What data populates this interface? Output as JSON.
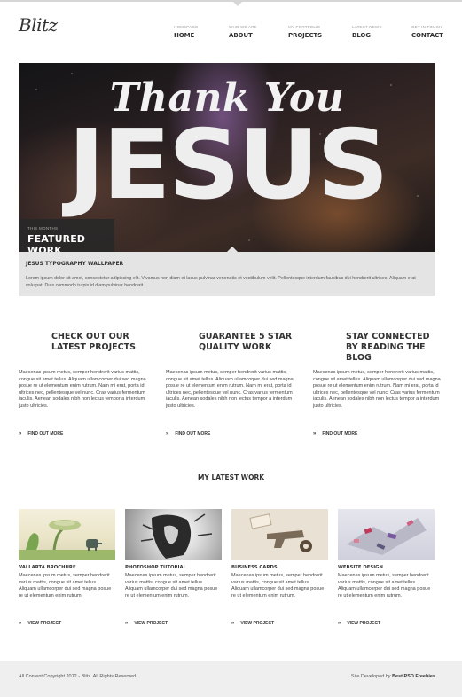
{
  "brand": {
    "logo": "Blitz"
  },
  "nav": [
    {
      "sub": "HOMEPAGE",
      "label": "HOME"
    },
    {
      "sub": "WHO WE ARE",
      "label": "ABOUT"
    },
    {
      "sub": "MY PORTFOLIO",
      "label": "PROJECTS"
    },
    {
      "sub": "LATEST NEWS",
      "label": "BLOG"
    },
    {
      "sub": "GET IN TOUCH",
      "label": "CONTACT"
    }
  ],
  "hero": {
    "line1": "Thank You",
    "line2": "JESUS",
    "featured_sub": "THIS MONTHS",
    "featured_title": "FEATURED WORK",
    "slide_count": 4,
    "active_slide": 4
  },
  "caption": {
    "title": "JESUS TYPOGRAPHY WALLPAPER",
    "text": "Lorem ipsum dolor sit amet, consectetur adipiscing elit. Vivamus non diam et lacus pulvinar venenatis et vestibulum velit. Pellentesque interdum faucibus dui hendrerit ultrices. Aliquam erat volutpat. Duis commodo turpis id diam pulvinar hendrerit."
  },
  "features": [
    {
      "title": "CHECK OUT OUR LATEST PROJECTS",
      "body": "Maecenas ipsum metus, semper hendrerit varius mattis, congue sit amet tellus. Aliquam ullamcorper dui sed magna posue re ut elementum enim rutrum. Nam mi erat, porta id ultrices nec, pellentesque vel nunc. Cras varius fermentum iaculis. Aenean sodales nibh non lectus tempor a interdum justo ultricies.",
      "link": "FIND OUT MORE"
    },
    {
      "title": "GUARANTEE 5 STAR QUALITY WORK",
      "body": "Maecenas ipsum metus, semper hendrerit varius mattis, congue sit amet tellus. Aliquam ullamcorper dui sed magna posue re ut elementum enim rutrum. Nam mi erat, porta id ultrices nec, pellentesque vel nunc. Cras varius fermentum iaculis. Aenean sodales nibh non lectus tempor a interdum justo ultricies.",
      "link": "FIND OUT MORE"
    },
    {
      "title": "STAY CONNECTED BY READING THE BLOG",
      "body": "Maecenas ipsum metus, semper hendrerit varius mattis, congue sit amet tellus. Aliquam ullamcorper dui sed magna posue re ut elementum enim rutrum. Nam mi erat, porta id ultrices nec, pellentesque vel nunc. Cras varius fermentum iaculis. Aenean sodales nibh non lectus tempor a interdum justo ultricies.",
      "link": "FIND OUT MORE"
    }
  ],
  "latest": {
    "heading": "MY LATEST WORK",
    "items": [
      {
        "title": "VALLARTA BROCHURE",
        "body": "Maecenas ipsum metus, semper hendrerit varius mattis, congue sit amet tellus. Aliquam ullamcorper dui sed magna posue re ut elementum enim rutrum.",
        "link": "VIEW PROJECT"
      },
      {
        "title": "PHOTOSHOP TUTORIAL",
        "body": "Maecenas ipsum metus, semper hendrerit varius mattis, congue sit amet tellus. Aliquam ullamcorper dui sed magna posue re ut elementum enim rutrum.",
        "link": "VIEW PROJECT"
      },
      {
        "title": "BUSINESS CARDS",
        "body": "Maecenas ipsum metus, semper hendrerit varius mattis, congue sit amet tellus. Aliquam ullamcorper dui sed magna posue re ut elementum enim rutrum.",
        "link": "VIEW PROJECT"
      },
      {
        "title": "WEBSITE DESIGN",
        "body": "Maecenas ipsum metus, semper hendrerit varius mattis, congue sit amet tellus. Aliquam ullamcorper dui sed magna posue re ut elementum enim rutrum.",
        "link": "VIEW PROJECT"
      }
    ]
  },
  "footer": {
    "copyright": "All Content Copyright 2012 - Blitz. All Rights Reserved.",
    "credit_prefix": "Site Developed by",
    "credit_name": "Best PSD Freebies"
  },
  "colors": {
    "text": "#333333",
    "caption_bg": "#e4e4e4",
    "footer_bg": "#efefef"
  }
}
